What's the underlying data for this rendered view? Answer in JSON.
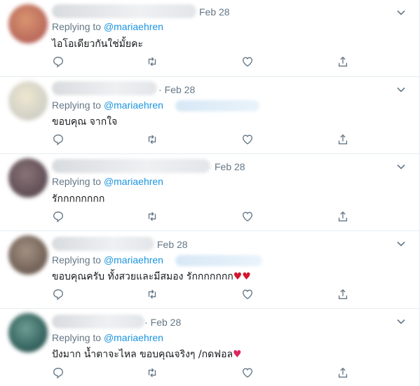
{
  "tweets": [
    {
      "date": "Feb 28",
      "replying_label": "Replying to",
      "handle": "@mariaehren",
      "text": "ไอโอเดียวกันใช่มั้ยคะ",
      "avatar_color": "#c9866f"
    },
    {
      "date": "Feb 28",
      "replying_label": "Replying to",
      "handle": "@mariaehren",
      "text": "ขอบคุณ จากใจ",
      "avatar_color": "#d9d6c4"
    },
    {
      "date": "Feb 28",
      "replying_label": "Replying to",
      "handle": "@mariaehren",
      "text": "รักกกกกกกก",
      "avatar_color": "#7e6a6f"
    },
    {
      "date": "Feb 28",
      "replying_label": "Replying to",
      "handle": "@mariaehren",
      "text": "ขอบคุณครับ ทั้งสวยและมีสมอง รักกกกกกก",
      "emoji": "♥♥",
      "avatar_color": "#8f7d71"
    },
    {
      "date": "Feb 28",
      "replying_label": "Replying to",
      "handle": "@mariaehren",
      "text": "ปังมาก น้ำตาจะไหล ขอบคุณจริงๆ /กดฟอล",
      "emoji": "♥",
      "avatar_color": "#4f7f77"
    }
  ],
  "icons": {
    "more": "chevron-down-icon",
    "reply": "reply-icon",
    "retweet": "retweet-icon",
    "like": "like-icon",
    "share": "share-icon"
  }
}
